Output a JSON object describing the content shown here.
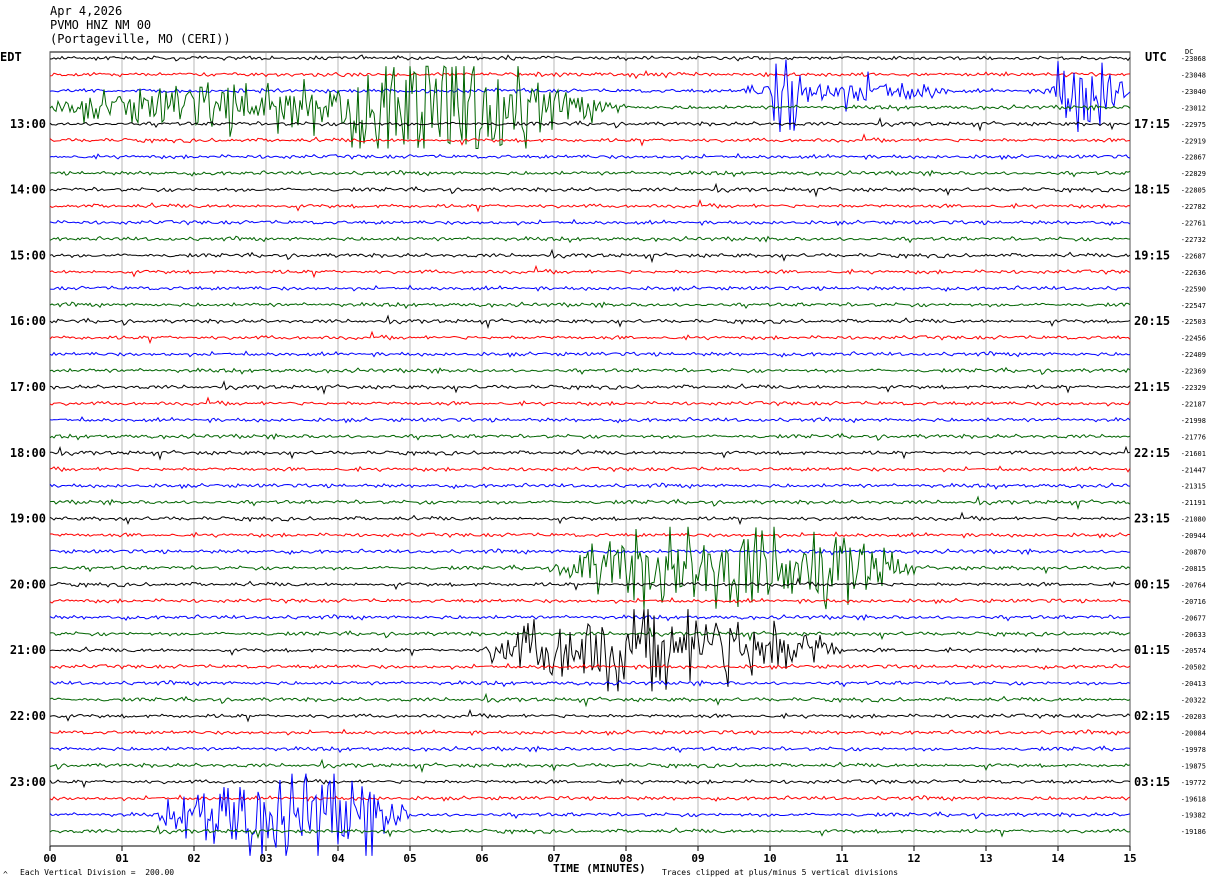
{
  "header": {
    "date": "Apr 4,2026",
    "channel": "PVMO HNZ NM 00",
    "location": "(Portageville, MO (CERI))"
  },
  "tz": {
    "left": "EDT",
    "right": "UTC",
    "dc": "DC"
  },
  "footer": {
    "vertical_division": "Each Vertical Division =  200.00",
    "clip_note": "Traces clipped at plus/minus 5 vertical divisions",
    "corner_mark": "^"
  },
  "colors": {
    "trace_cycle": [
      "#000000",
      "#ff0000",
      "#0000ff",
      "#006400"
    ],
    "grid": "#888888"
  },
  "chart_data": {
    "type": "line",
    "subtype": "helicorder",
    "xlabel": "TIME (MINUTES)",
    "x_ticks": [
      "00",
      "01",
      "02",
      "03",
      "04",
      "05",
      "06",
      "07",
      "08",
      "09",
      "10",
      "11",
      "12",
      "13",
      "14",
      "15"
    ],
    "xlim": [
      0,
      15
    ],
    "line_count": 48,
    "minutes_per_line": 15,
    "left_hour_labels": [
      "13:00",
      "14:00",
      "15:00",
      "16:00",
      "17:00",
      "18:00",
      "19:00",
      "20:00",
      "21:00",
      "22:00",
      "23:00"
    ],
    "right_hour_labels": [
      "17:15",
      "18:15",
      "19:15",
      "20:15",
      "21:15",
      "22:15",
      "23:15",
      "00:15",
      "01:15",
      "02:15",
      "03:15"
    ],
    "dc_offsets": [
      "-23068",
      "-23048",
      "-23040",
      "-23012",
      "-22975",
      "-22919",
      "-22867",
      "-22829",
      "-22805",
      "-22782",
      "-22761",
      "-22732",
      "-22687",
      "-22636",
      "-22590",
      "-22547",
      "-22503",
      "-22456",
      "-22409",
      "-22369",
      "-22329",
      "-22187",
      "-21998",
      "-21776",
      "-21601",
      "-21447",
      "-21315",
      "-21191",
      "-21080",
      "-20944",
      "-20870",
      "-20815",
      "-20764",
      "-20716",
      "-20677",
      "-20633",
      "-20574",
      "-20502",
      "-20413",
      "-20322",
      "-20203",
      "-20084",
      "-19978",
      "-19875",
      "-19772",
      "-19618",
      "-19382",
      "-19186"
    ],
    "events": [
      {
        "line": 3,
        "start_min": 0.0,
        "end_min": 8.0,
        "amp": 6
      },
      {
        "line": 3,
        "start_min": 4.0,
        "end_min": 7.0,
        "amp": 10
      },
      {
        "line": 2,
        "start_min": 9.6,
        "end_min": 12.5,
        "amp": 3
      },
      {
        "line": 2,
        "start_min": 10.0,
        "end_min": 10.5,
        "amp": 10
      },
      {
        "line": 2,
        "start_min": 13.8,
        "end_min": 15.0,
        "amp": 10
      },
      {
        "line": 31,
        "start_min": 7.0,
        "end_min": 12.0,
        "amp": 10
      },
      {
        "line": 36,
        "start_min": 6.0,
        "end_min": 11.0,
        "amp": 10
      },
      {
        "line": 46,
        "start_min": 1.5,
        "end_min": 5.0,
        "amp": 10
      }
    ]
  }
}
